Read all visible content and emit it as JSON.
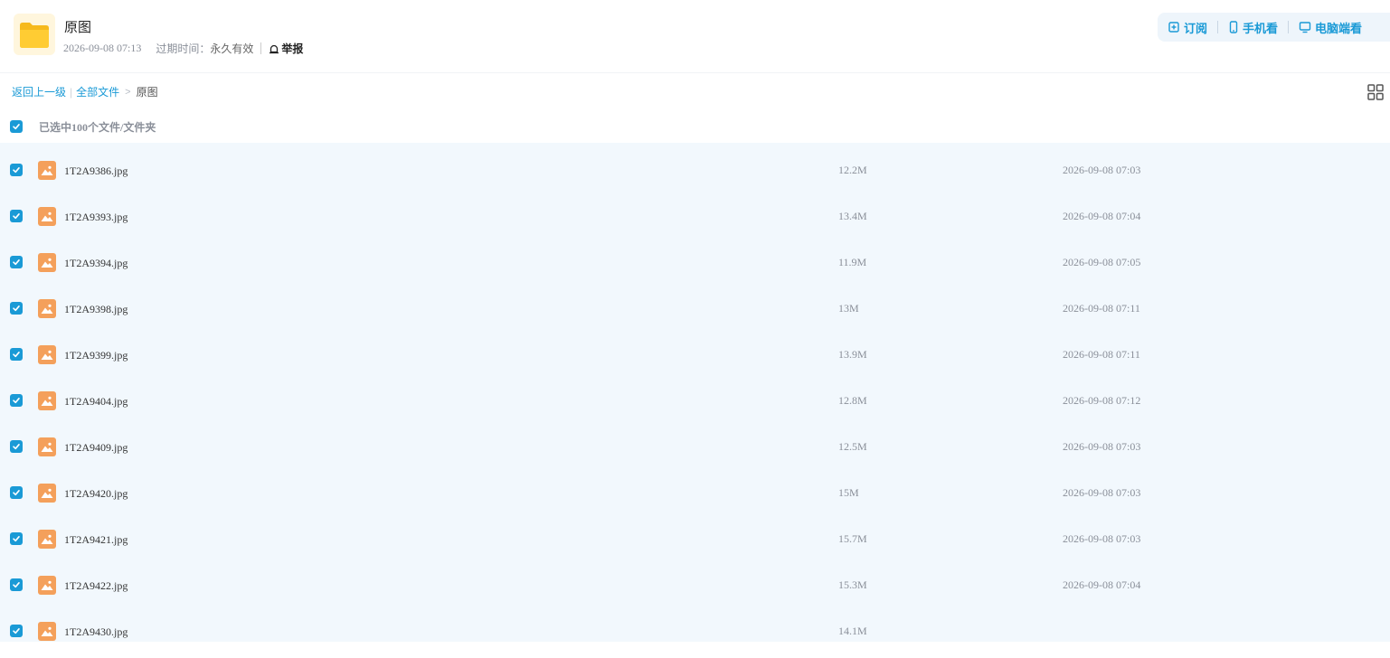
{
  "header": {
    "folder_icon": "folder-icon",
    "title": "原图",
    "date": "2026-09-08 07:13",
    "expire_label": "过期时间：",
    "expire_value": "永久有效",
    "report_label": "举报"
  },
  "actions": {
    "subscribe": "订阅",
    "mobile": "手机看",
    "desktop": "电脑端看"
  },
  "breadcrumb": {
    "back": "返回上一级",
    "all_files": "全部文件",
    "current": "原图"
  },
  "selection": {
    "text": "已选中100个文件/文件夹"
  },
  "colors": {
    "accent": "#1a9ad6",
    "list_bg": "#f2f8fd",
    "file_icon": "#f4a05b"
  },
  "files": [
    {
      "name": "1T2A9386.jpg",
      "size": "12.2M",
      "date": "2026-09-08 07:03"
    },
    {
      "name": "1T2A9393.jpg",
      "size": "13.4M",
      "date": "2026-09-08 07:04"
    },
    {
      "name": "1T2A9394.jpg",
      "size": "11.9M",
      "date": "2026-09-08 07:05"
    },
    {
      "name": "1T2A9398.jpg",
      "size": "13M",
      "date": "2026-09-08 07:11"
    },
    {
      "name": "1T2A9399.jpg",
      "size": "13.9M",
      "date": "2026-09-08 07:11"
    },
    {
      "name": "1T2A9404.jpg",
      "size": "12.8M",
      "date": "2026-09-08 07:12"
    },
    {
      "name": "1T2A9409.jpg",
      "size": "12.5M",
      "date": "2026-09-08 07:03"
    },
    {
      "name": "1T2A9420.jpg",
      "size": "15M",
      "date": "2026-09-08 07:03"
    },
    {
      "name": "1T2A9421.jpg",
      "size": "15.7M",
      "date": "2026-09-08 07:03"
    },
    {
      "name": "1T2A9422.jpg",
      "size": "15.3M",
      "date": "2026-09-08 07:04"
    },
    {
      "name": "1T2A9430.jpg",
      "size": "14.1M",
      "date": ""
    }
  ]
}
